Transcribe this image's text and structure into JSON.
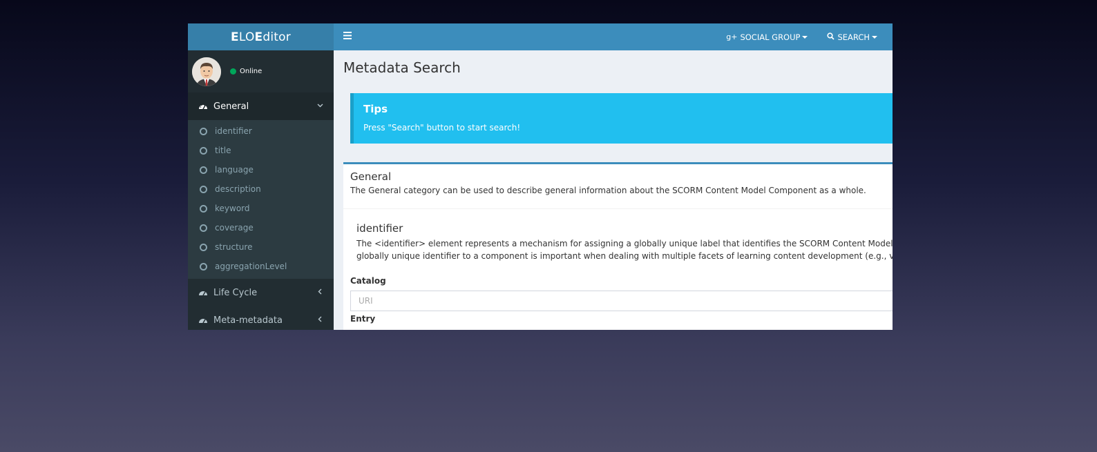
{
  "logo": {
    "first_bold": "E",
    "first_rest": "LO ",
    "second_bold": "E",
    "second_rest": "ditor"
  },
  "user": {
    "status": "Online",
    "status_color": "#00a65a"
  },
  "sidebar": {
    "sections": [
      {
        "label": "General",
        "expanded": true,
        "items": [
          "identifier",
          "title",
          "language",
          "description",
          "keyword",
          "coverage",
          "structure",
          "aggregationLevel"
        ]
      },
      {
        "label": "Life Cycle",
        "expanded": false
      },
      {
        "label": "Meta-metadata",
        "expanded": false
      }
    ]
  },
  "header": {
    "menu_icon": "hamburger-icon",
    "social_group": "SOCIAL GROUP",
    "search": "SEARCH"
  },
  "main": {
    "page_title": "Metadata Search",
    "tips": {
      "title": "Tips",
      "text": "Press \"Search\" button to start search!"
    },
    "box": {
      "title": "General",
      "description": "The General category can be used to describe general information about the SCORM Content Model Component as a whole.",
      "sub_title": "identifier",
      "sub_desc_line1": "The <identifier> element represents a mechanism for assigning a globally unique label that identifies the SCORM Content Model Component. T",
      "sub_desc_line2": "globally unique identifier to a component is important when dealing with multiple facets of learning content development (e.g., versioning, ma",
      "catalog_label": "Catalog",
      "catalog_placeholder": "URI",
      "entry_label": "Entry"
    }
  },
  "colors": {
    "header": "#3c8dbc",
    "logo_bg": "#367fa9",
    "sidebar": "#222d32",
    "tips": "#21bfef"
  }
}
